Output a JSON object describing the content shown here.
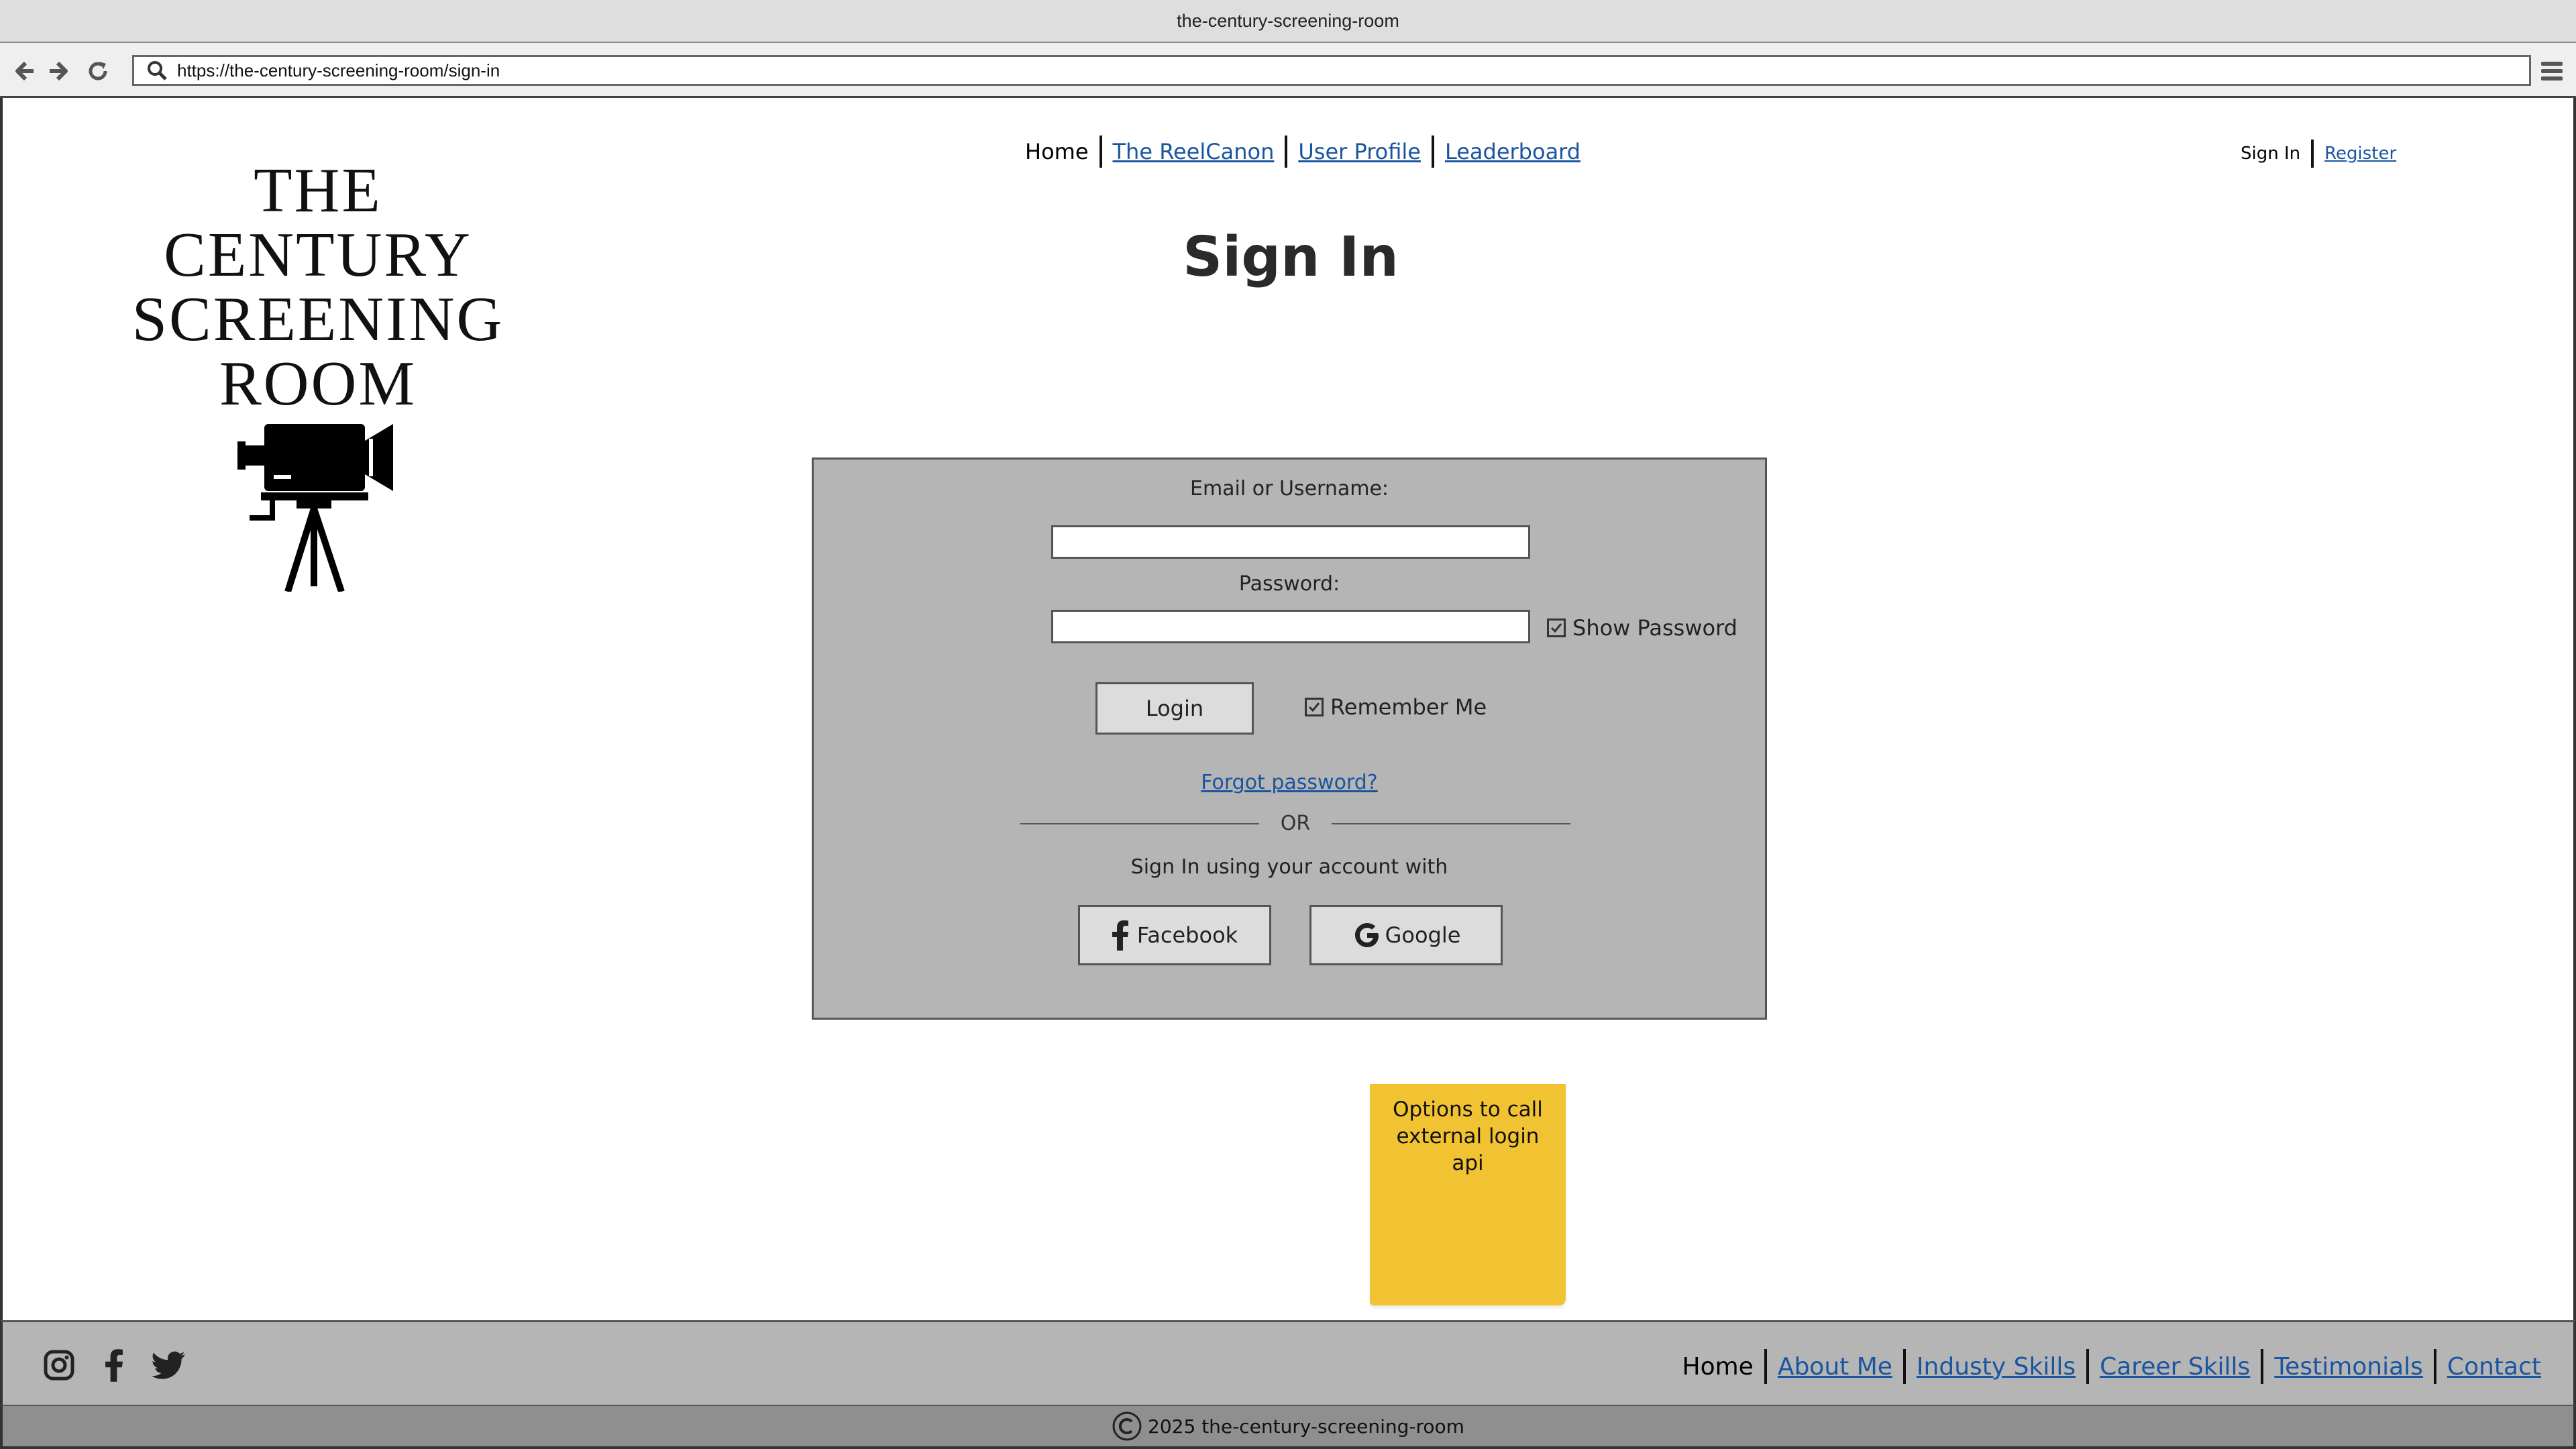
{
  "browser": {
    "window_title": "the-century-screening-room",
    "url": "https://the-century-screening-room/sign-in"
  },
  "logo": {
    "line1": "THE CENTURY",
    "line2": "SCREENING",
    "line3": "ROOM"
  },
  "main_nav": {
    "items": [
      {
        "label": "Home",
        "current": true
      },
      {
        "label": "The ReelCanon"
      },
      {
        "label": "User Profile"
      },
      {
        "label": "Leaderboard"
      }
    ]
  },
  "auth_nav": {
    "sign_in": "Sign In",
    "register": "Register"
  },
  "page_title": "Sign In",
  "form": {
    "email_label": "Email or Username:",
    "email_value": "",
    "password_label": "Password:",
    "password_value": "",
    "show_password_label": "Show Password",
    "show_password_checked": true,
    "login_button": "Login",
    "remember_me_label": "Remember Me",
    "remember_me_checked": true,
    "forgot_password": "Forgot password?",
    "or_text": "OR",
    "social_prompt": "Sign In using your account with",
    "facebook_button": "Facebook",
    "google_button": "Google"
  },
  "sticky_note": {
    "text": "Options to call external login api",
    "color": "#f1c232"
  },
  "footer": {
    "social_icons": [
      "instagram-icon",
      "facebook-icon",
      "twitter-icon"
    ],
    "nav": [
      {
        "label": "Home",
        "current": true
      },
      {
        "label": "About Me"
      },
      {
        "label": "Industy Skills"
      },
      {
        "label": "Career Skills"
      },
      {
        "label": "Testimonials"
      },
      {
        "label": "Contact"
      }
    ],
    "copyright": "2025 the-century-screening-room"
  },
  "colors": {
    "link": "#1a55a0",
    "panel": "#b5b5b5",
    "footer": "#b5b5b5",
    "copyright_bar": "#8f8f8f"
  }
}
